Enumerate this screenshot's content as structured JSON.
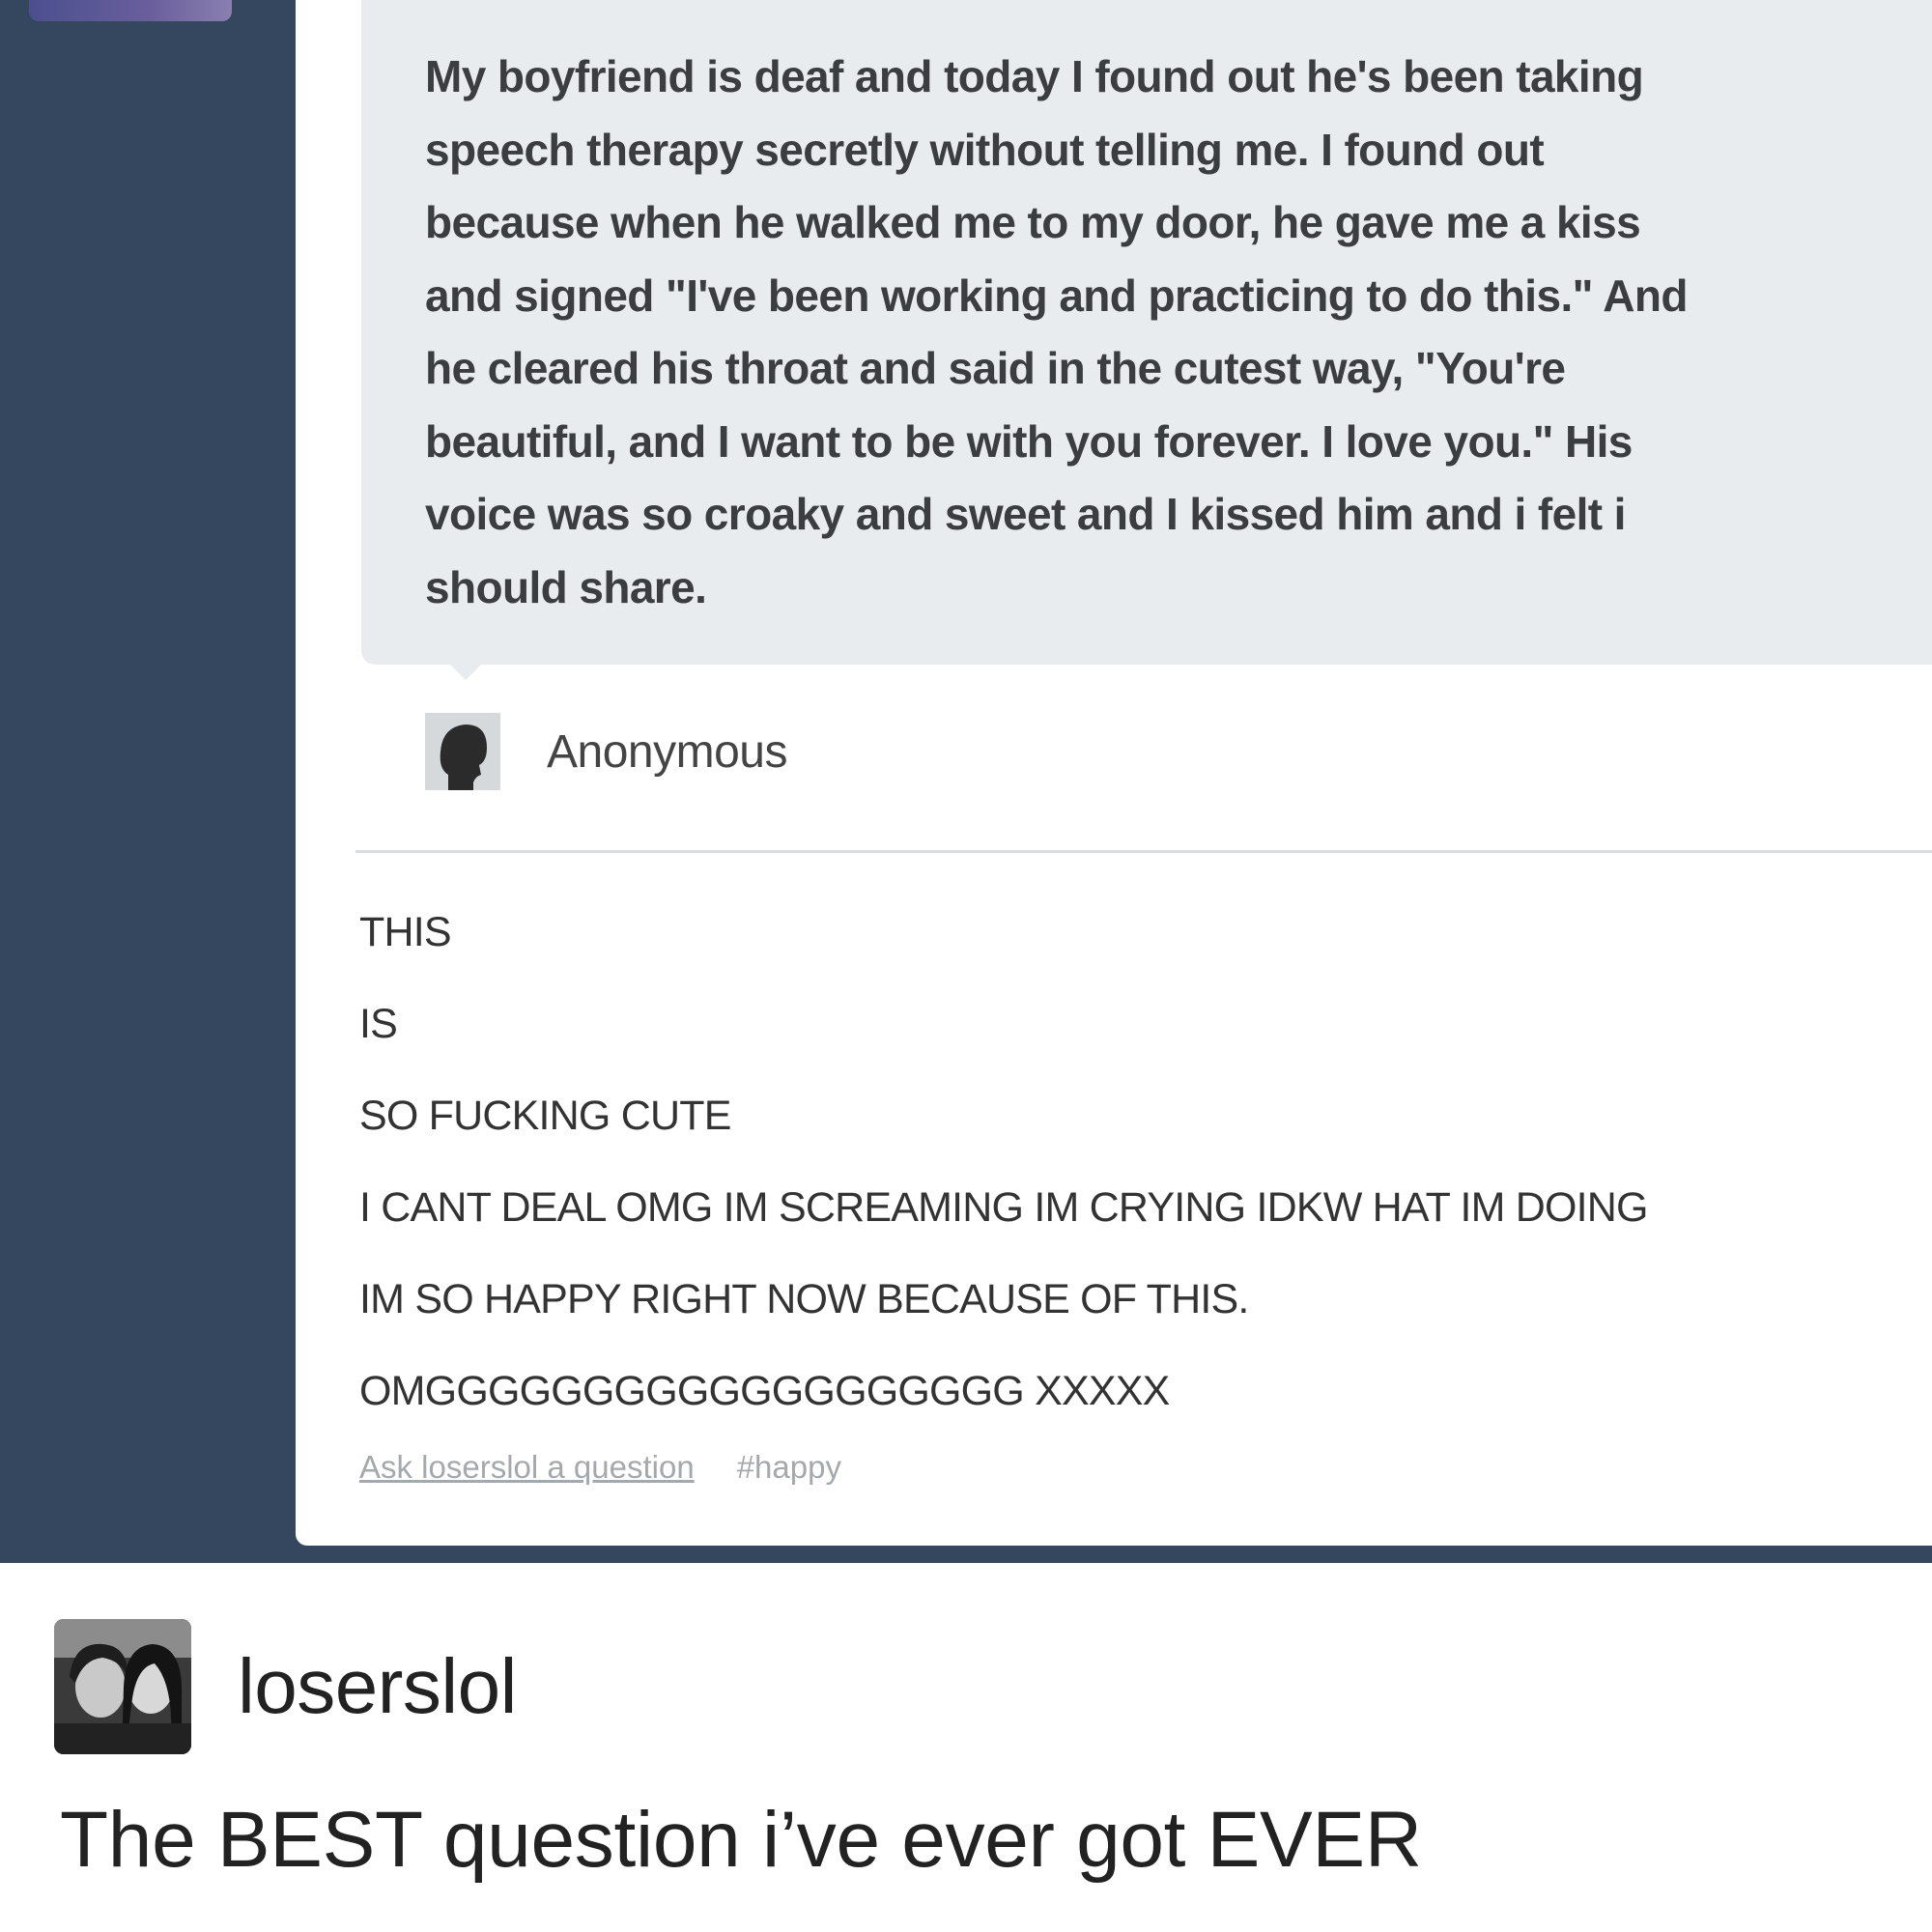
{
  "post": {
    "question": "My boyfriend is deaf and today I found out he's been taking speech therapy secretly without telling me. I found out because when he walked me to my door, he gave me a kiss and signed \"I've been working and practicing to do this.\" And he cleared his throat and said in the cutest way, \"You're beautiful, and I want to be with you forever. I love you.\" His voice was so croaky and sweet and I kissed him and i felt i should share.",
    "question_lines": [
      "My boyfriend is deaf and today I found out he's been taking",
      "speech therapy secretly without telling me. I found out",
      "because when he walked me to my door, he gave me a kiss",
      "and signed \"I've been working and practicing to do this.\" And",
      "he cleared his throat and said in the cutest way, \"You're",
      "beautiful, and I want to be with you forever. I love you.\" His",
      "voice was so croaky and sweet and I kissed him and i felt i",
      "should share."
    ],
    "asker": {
      "name": "Anonymous",
      "icon": "anonymous-avatar-icon"
    },
    "answer_lines": [
      "THIS",
      "IS",
      "SO FUCKING CUTE",
      "I CANT DEAL OMG IM SCREAMING IM CRYING IDKW HAT IM DOING",
      "IM SO HAPPY RIGHT NOW BECAUSE OF THIS.",
      "OMGGGGGGGGGGGGGGGGGGG XXXXX"
    ],
    "footer": {
      "ask_link": "Ask loserslol a question",
      "tag": "#happy"
    }
  },
  "repost": {
    "username": "loserslol",
    "caption": "The BEST question i’ve ever got EVER"
  },
  "colors": {
    "dashboard_bg": "#34475f",
    "bubble_bg": "#e9ecef",
    "footer_text": "#a4a9ae"
  }
}
